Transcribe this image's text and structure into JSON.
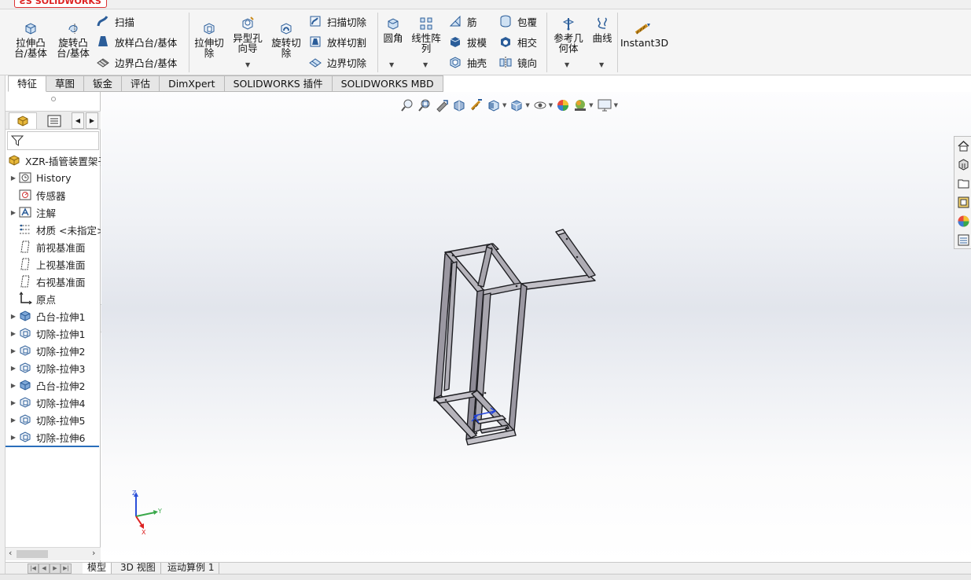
{
  "app": {
    "logo_text": "SOLIDWORKS"
  },
  "ribbon": {
    "extrude_boss": "拉伸凸\n台/基体",
    "revolve_boss": "旋转凸\n台/基体",
    "sweep": "扫描",
    "loft_boss": "放样凸台/基体",
    "boundary_boss": "边界凸台/基体",
    "extrude_cut": "拉伸切\n除",
    "hole_wizard": "异型孔\n向导",
    "revolve_cut": "旋转切\n除",
    "sweep_cut": "扫描切除",
    "loft_cut": "放样切割",
    "boundary_cut": "边界切除",
    "fillet": "圆角",
    "linear_pattern": "线性阵\n列",
    "rib": "筋",
    "wrap": "包覆",
    "draft": "拔模",
    "intersect": "相交",
    "shell": "抽壳",
    "mirror": "镜向",
    "reference_geometry": "参考几\n何体",
    "curves": "曲线",
    "instant3d": "Instant3D"
  },
  "tabs": [
    "特征",
    "草图",
    "钣金",
    "评估",
    "DimXpert",
    "SOLIDWORKS 插件",
    "SOLIDWORKS MBD"
  ],
  "feature_tree": {
    "root": "XZR-插管装置架子",
    "items": [
      {
        "label": "History",
        "expand": true,
        "icon": "history-icon"
      },
      {
        "label": "传感器",
        "expand": false,
        "icon": "sensor-icon"
      },
      {
        "label": "注解",
        "expand": true,
        "icon": "annotation-icon"
      },
      {
        "label": "材质 <未指定>",
        "expand": false,
        "icon": "material-icon"
      },
      {
        "label": "前视基准面",
        "expand": false,
        "icon": "plane-icon"
      },
      {
        "label": "上视基准面",
        "expand": false,
        "icon": "plane-icon"
      },
      {
        "label": "右视基准面",
        "expand": false,
        "icon": "plane-icon"
      },
      {
        "label": "原点",
        "expand": false,
        "icon": "origin-icon"
      },
      {
        "label": "凸台-拉伸1",
        "expand": true,
        "icon": "boss-extrude-icon"
      },
      {
        "label": "切除-拉伸1",
        "expand": true,
        "icon": "cut-extrude-icon"
      },
      {
        "label": "切除-拉伸2",
        "expand": true,
        "icon": "cut-extrude-icon"
      },
      {
        "label": "切除-拉伸3",
        "expand": true,
        "icon": "cut-extrude-icon"
      },
      {
        "label": "凸台-拉伸2",
        "expand": true,
        "icon": "boss-extrude-icon"
      },
      {
        "label": "切除-拉伸4",
        "expand": true,
        "icon": "cut-extrude-icon"
      },
      {
        "label": "切除-拉伸5",
        "expand": true,
        "icon": "cut-extrude-icon"
      },
      {
        "label": "切除-拉伸6",
        "expand": true,
        "icon": "cut-extrude-icon"
      }
    ]
  },
  "triad": {
    "x": "X",
    "y": "Y",
    "z": "Z"
  },
  "bottom_tabs": [
    "模型",
    "3D 视图",
    "运动算例 1"
  ],
  "colors": {
    "accent": "#2a6ebb",
    "model_fill": "#9b98a2",
    "model_edge": "#1e1e22"
  }
}
